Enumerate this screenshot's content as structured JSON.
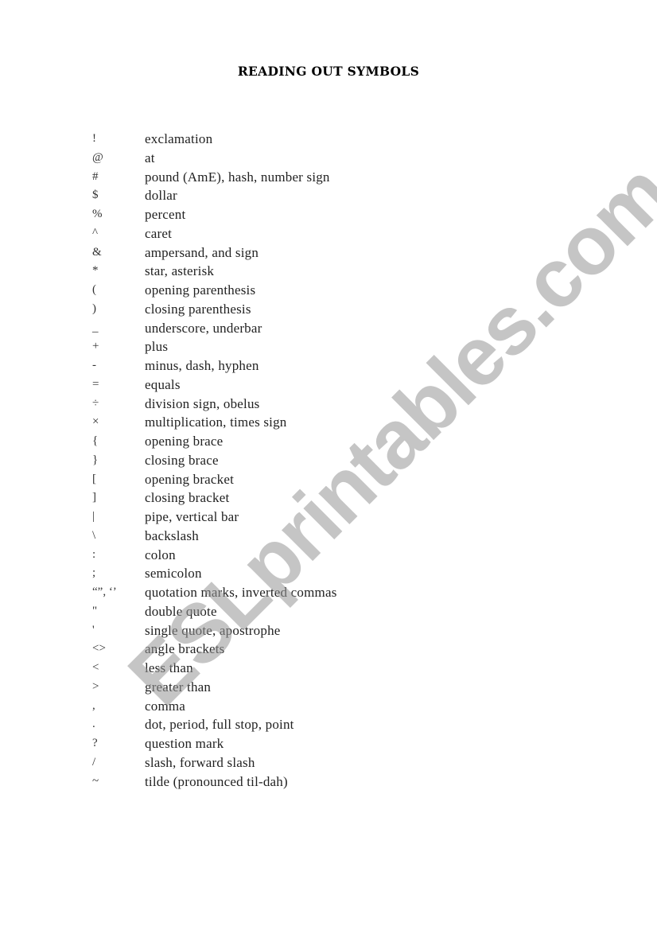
{
  "title": "READING OUT SYMBOLS",
  "watermark": "ESLprintables.com",
  "items": [
    {
      "symbol": "!",
      "description": "exclamation"
    },
    {
      "symbol": "@",
      "description": "at"
    },
    {
      "symbol": "#",
      "description": "pound (AmE), hash, number sign"
    },
    {
      "symbol": "$",
      "description": "dollar"
    },
    {
      "symbol": "%",
      "description": "percent"
    },
    {
      "symbol": "^",
      "description": "caret"
    },
    {
      "symbol": "&",
      "description": "ampersand, and sign"
    },
    {
      "symbol": "*",
      "description": "star, asterisk"
    },
    {
      "symbol": "(",
      "description": "opening parenthesis"
    },
    {
      "symbol": ")",
      "description": "closing parenthesis"
    },
    {
      "symbol": "_",
      "description": "underscore, underbar"
    },
    {
      "symbol": "+",
      "description": "plus"
    },
    {
      "symbol": "-",
      "description": "minus, dash, hyphen"
    },
    {
      "symbol": "=",
      "description": "equals"
    },
    {
      "symbol": "÷",
      "description": "division sign, obelus"
    },
    {
      "symbol": "×",
      "description": "multiplication, times sign"
    },
    {
      "symbol": "{",
      "description": "opening brace"
    },
    {
      "symbol": "}",
      "description": "closing brace"
    },
    {
      "symbol": "[",
      "description": "opening bracket"
    },
    {
      "symbol": "]",
      "description": "closing bracket"
    },
    {
      "symbol": "|",
      "description": "pipe, vertical bar"
    },
    {
      "symbol": "\\",
      "description": "backslash"
    },
    {
      "symbol": ":",
      "description": "colon"
    },
    {
      "symbol": ";",
      "description": "semicolon"
    },
    {
      "symbol": "“”, ‘’",
      "description": "quotation marks, inverted commas"
    },
    {
      "symbol": "\"",
      "description": "double quote"
    },
    {
      "symbol": "'",
      "description": "single quote, apostrophe"
    },
    {
      "symbol": "<>",
      "description": "angle brackets"
    },
    {
      "symbol": "<",
      "description": "less than"
    },
    {
      "symbol": ">",
      "description": "greater than"
    },
    {
      "symbol": ",",
      "description": "comma"
    },
    {
      "symbol": ".",
      "description": "dot, period, full stop, point"
    },
    {
      "symbol": "?",
      "description": "question mark"
    },
    {
      "symbol": "/",
      "description": "slash, forward slash"
    },
    {
      "symbol": "~",
      "description": "tilde (pronounced til-dah)"
    }
  ]
}
